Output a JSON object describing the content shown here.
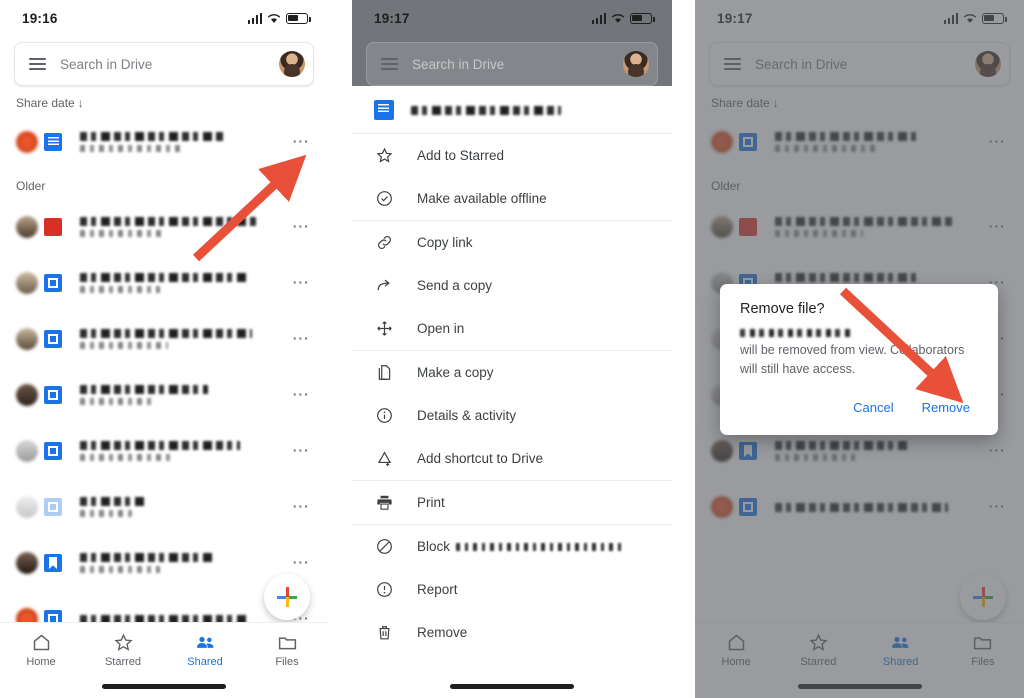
{
  "panels": {
    "left": {
      "status": {
        "time": "19:16"
      },
      "search": {
        "placeholder": "Search in Drive",
        "menu_icon": "hamburger-icon",
        "avatar": "account-avatar"
      },
      "sort": {
        "label": "Share date",
        "direction_icon": "↓"
      },
      "group_label": "Older",
      "nav": {
        "items": [
          {
            "label": "Home",
            "icon": "home-icon",
            "active": false
          },
          {
            "label": "Starred",
            "icon": "star-icon",
            "active": false
          },
          {
            "label": "Shared",
            "icon": "people-icon",
            "active": true
          },
          {
            "label": "Files",
            "icon": "folder-icon",
            "active": false
          }
        ]
      },
      "fab": {
        "label": "New",
        "icon": "plus-icon"
      },
      "files": [
        {
          "type": "slides",
          "redacted": true
        },
        {
          "type": "pdf",
          "redacted": true
        },
        {
          "type": "blue2",
          "redacted": true
        },
        {
          "type": "docs",
          "redacted": true
        },
        {
          "type": "blue2",
          "redacted": true
        },
        {
          "type": "blue2",
          "redacted": true
        },
        {
          "type": "blue2",
          "redacted": true
        },
        {
          "type": "bookmark",
          "redacted": true
        },
        {
          "type": "folder",
          "redacted": true
        }
      ]
    },
    "middle": {
      "status": {
        "time": "19:17"
      },
      "search": {
        "placeholder": "Search in Drive"
      },
      "file_header": {
        "icon": "google-docs-icon",
        "name_redacted": true
      },
      "menu_items": [
        {
          "label": "Add to Starred",
          "icon": "star-outline-icon"
        },
        {
          "label": "Make available offline",
          "icon": "offline-check-icon"
        },
        {
          "label": "Copy link",
          "icon": "link-icon"
        },
        {
          "label": "Send a copy",
          "icon": "share-arrow-icon"
        },
        {
          "label": "Open in",
          "icon": "open-in-icon"
        },
        {
          "label": "Make a copy",
          "icon": "copy-icon"
        },
        {
          "label": "Details & activity",
          "icon": "info-icon"
        },
        {
          "label": "Add shortcut to Drive",
          "icon": "add-shortcut-icon"
        },
        {
          "label": "Print",
          "icon": "print-icon"
        },
        {
          "label": "Block",
          "icon": "block-icon",
          "suffix_redacted": true
        },
        {
          "label": "Report",
          "icon": "report-icon"
        },
        {
          "label": "Remove",
          "icon": "trash-icon"
        }
      ]
    },
    "right": {
      "status": {
        "time": "19:17"
      },
      "search": {
        "placeholder": "Search in Drive"
      },
      "sort": {
        "label": "Share date",
        "direction_icon": "↓"
      },
      "group_label": "Older",
      "dialog": {
        "title": "Remove file?",
        "body_prefix_redacted": true,
        "body_text": "will be removed from view. Collaborators will still have access.",
        "cancel_label": "Cancel",
        "confirm_label": "Remove"
      },
      "nav": {
        "items": [
          {
            "label": "Home",
            "icon": "home-icon",
            "active": false
          },
          {
            "label": "Starred",
            "icon": "star-icon",
            "active": false
          },
          {
            "label": "Shared",
            "icon": "people-icon",
            "active": true
          },
          {
            "label": "Files",
            "icon": "folder-icon",
            "active": false
          }
        ]
      },
      "files": [
        {
          "type": "slides",
          "redacted": true
        },
        {
          "type": "pdf",
          "redacted": true
        },
        {
          "type": "img",
          "redacted": true
        },
        {
          "type": "folderg",
          "redacted": true
        },
        {
          "type": "bookmark",
          "redacted": true
        },
        {
          "type": "blue2",
          "redacted": true
        }
      ]
    }
  },
  "annotations": {
    "arrow_color": "#e8503a",
    "arrows": [
      {
        "name": "arrow-to-overflow-menu",
        "target": "overflow-menu-left-panel"
      },
      {
        "name": "arrow-to-remove-menu-item",
        "target": "menu-item-remove"
      },
      {
        "name": "arrow-to-remove-confirm",
        "target": "dialog-remove-button"
      }
    ]
  },
  "colors": {
    "accent_blue": "#1a73e8",
    "overlay_gray": "#72767a",
    "text_primary": "#3c4043",
    "text_secondary": "#5f6368",
    "arrow_red": "#e8503a"
  }
}
